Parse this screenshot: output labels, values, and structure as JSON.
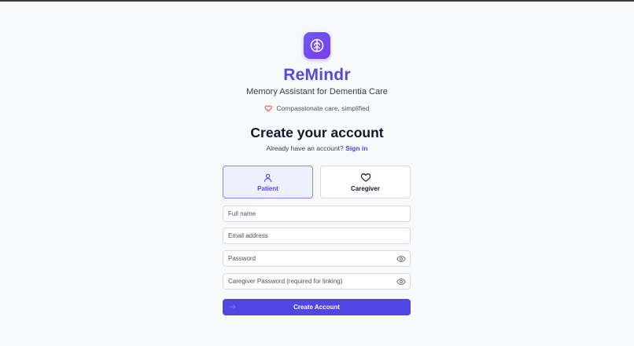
{
  "app": {
    "name": "ReMindr",
    "subtitle": "Memory Assistant for Dementia Care",
    "tagline": "Compassionate care, simplified"
  },
  "form": {
    "heading": "Create your account",
    "signin_prompt": "Already have an account?",
    "signin_link": "Sign in",
    "roles": [
      {
        "label": "Patient",
        "selected": true,
        "icon": "user-icon"
      },
      {
        "label": "Caregiver",
        "selected": false,
        "icon": "heart-icon"
      }
    ],
    "fields": {
      "full_name": {
        "placeholder": "Full name",
        "value": ""
      },
      "email": {
        "placeholder": "Email address",
        "value": ""
      },
      "password": {
        "placeholder": "Password",
        "value": ""
      },
      "caregiver_password": {
        "placeholder": "Caregiver Password (required for linking)",
        "value": ""
      }
    },
    "submit_label": "Create Account"
  },
  "colors": {
    "brand": "#5b46e0",
    "primary": "#4f46e5",
    "heart_accent": "#ef4444",
    "selected_role_bg": "#eef0fd"
  }
}
